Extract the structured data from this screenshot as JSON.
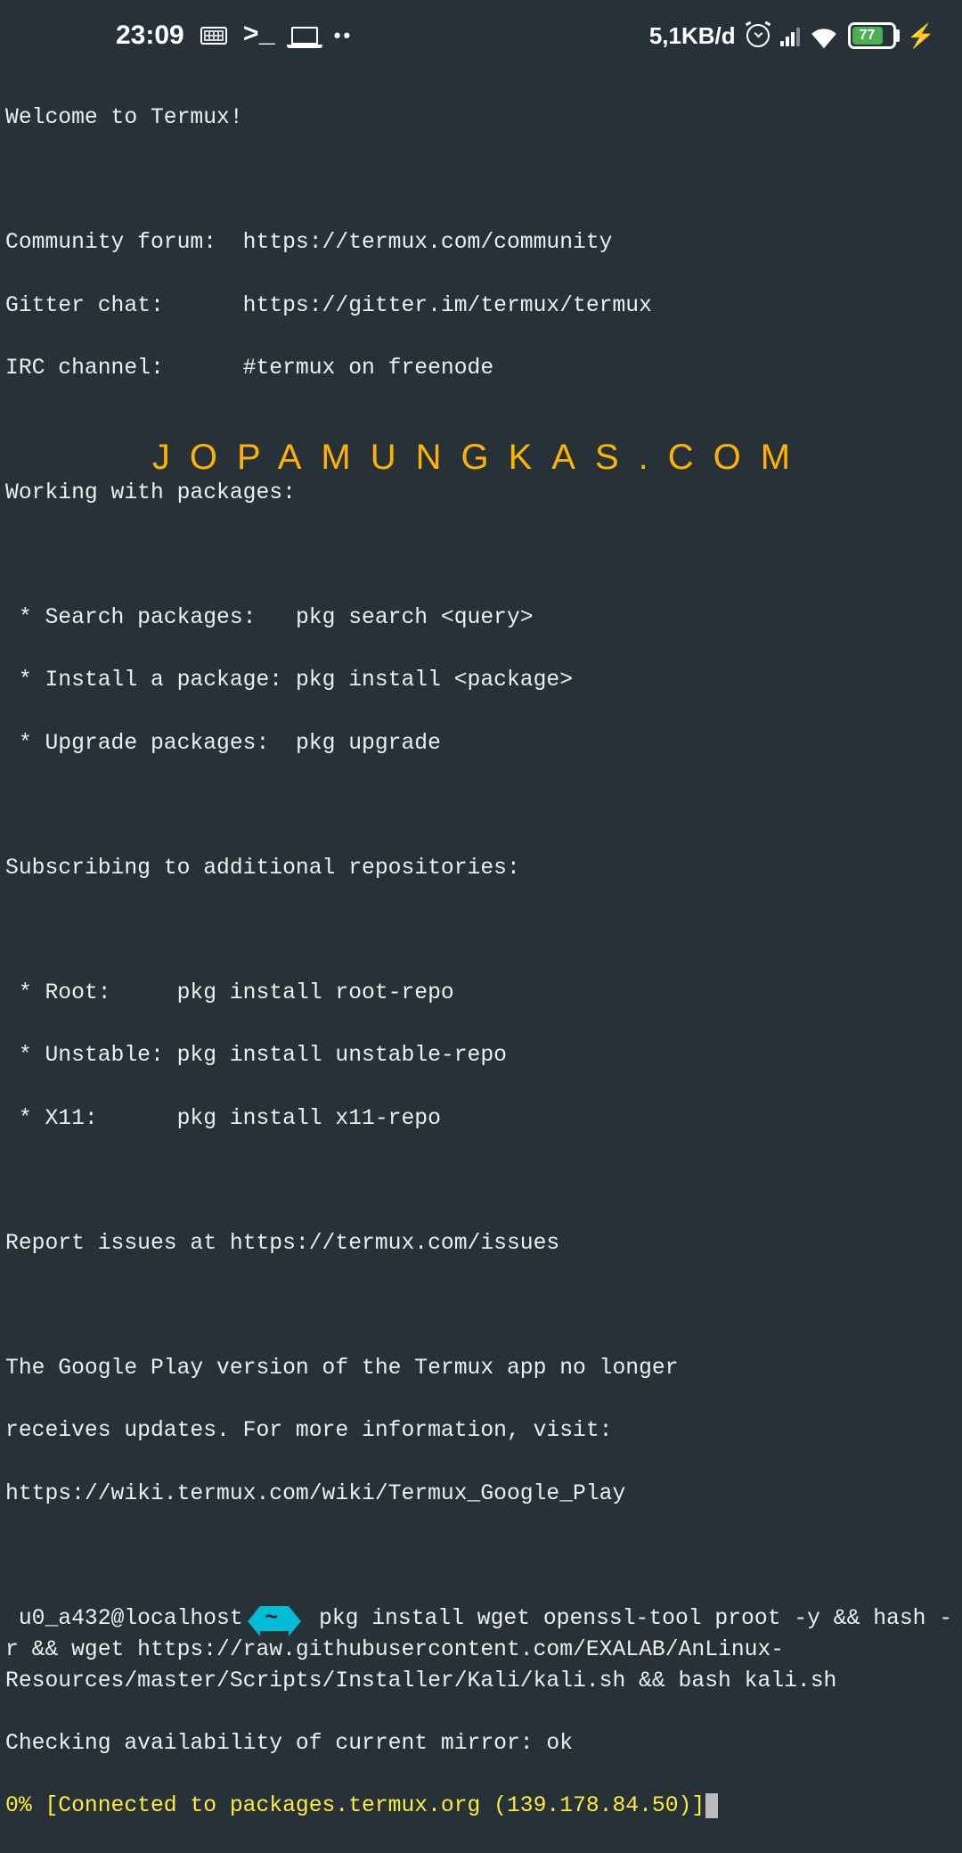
{
  "status": {
    "time": "23:09",
    "network_rate": "5,1KB/d",
    "battery_pct": 77,
    "battery_text": "77"
  },
  "watermark": "JOPAMUNGKAS.COM",
  "terminal": {
    "welcome": "Welcome to Termux!",
    "forum_line": "Community forum:  https://termux.com/community",
    "gitter_line": "Gitter chat:      https://gitter.im/termux/termux",
    "irc_line": "IRC channel:      #termux on freenode",
    "pkg_header": "Working with packages:",
    "pkg_search": " * Search packages:   pkg search <query>",
    "pkg_install": " * Install a package: pkg install <package>",
    "pkg_upgrade": " * Upgrade packages:  pkg upgrade",
    "repo_header": "Subscribing to additional repositories:",
    "repo_root": " * Root:     pkg install root-repo",
    "repo_unstable": " * Unstable: pkg install unstable-repo",
    "repo_x11": " * X11:      pkg install x11-repo",
    "issues": "Report issues at https://termux.com/issues",
    "deprecation1": "The Google Play version of the Termux app no longer",
    "deprecation2": "receives updates. For more information, visit:",
    "deprecation3": "https://wiki.termux.com/wiki/Termux_Google_Play",
    "prompt_user": " u0_a432@localhost",
    "prompt_dir": "~",
    "command": "pkg install wget openssl-tool proot -y && hash -r && wget https://raw.githubusercontent.com/EXALAB/AnLinux-Resources/master/Scripts/Installer/Kali/kali.sh && bash kali.sh",
    "mirror_line": "Checking availability of current mirror: ok",
    "progress_line": "0% [Connected to packages.termux.org (139.178.84.50)]"
  }
}
